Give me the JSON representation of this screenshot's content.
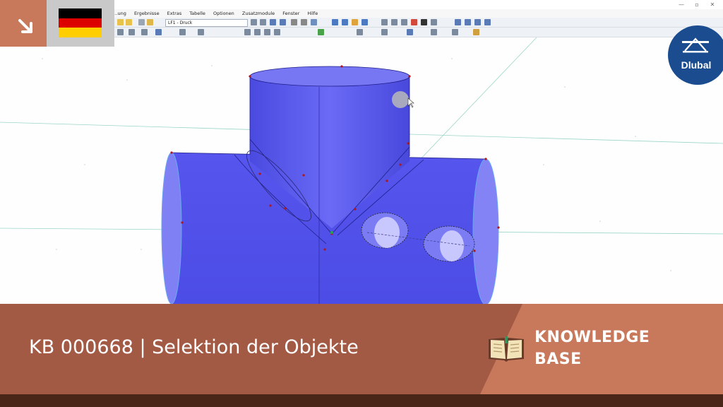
{
  "window": {
    "controls": [
      "—",
      "▫",
      "✕"
    ]
  },
  "menu": {
    "items": [
      "…ung",
      "Ergebnisse",
      "Extras",
      "Tabelle",
      "Optionen",
      "Zusatzmodule",
      "Fenster",
      "Hilfe"
    ]
  },
  "toolbar": {
    "loadcase_value": "LF1 - Druck"
  },
  "language_flag": "de",
  "brand": {
    "logo_text": "Dlubal",
    "logo_color": "#1a4c8f"
  },
  "banner": {
    "title": "KB 000668 | Selektion der Objekte",
    "label_line1": "KNOWLEDGE",
    "label_line2": "BASE",
    "color_dark": "#a35a45",
    "color_light": "#c8795c"
  },
  "colors": {
    "model_fill": "#5b5bf0",
    "model_edge": "#1f1f8a",
    "background": "#fefefe"
  }
}
